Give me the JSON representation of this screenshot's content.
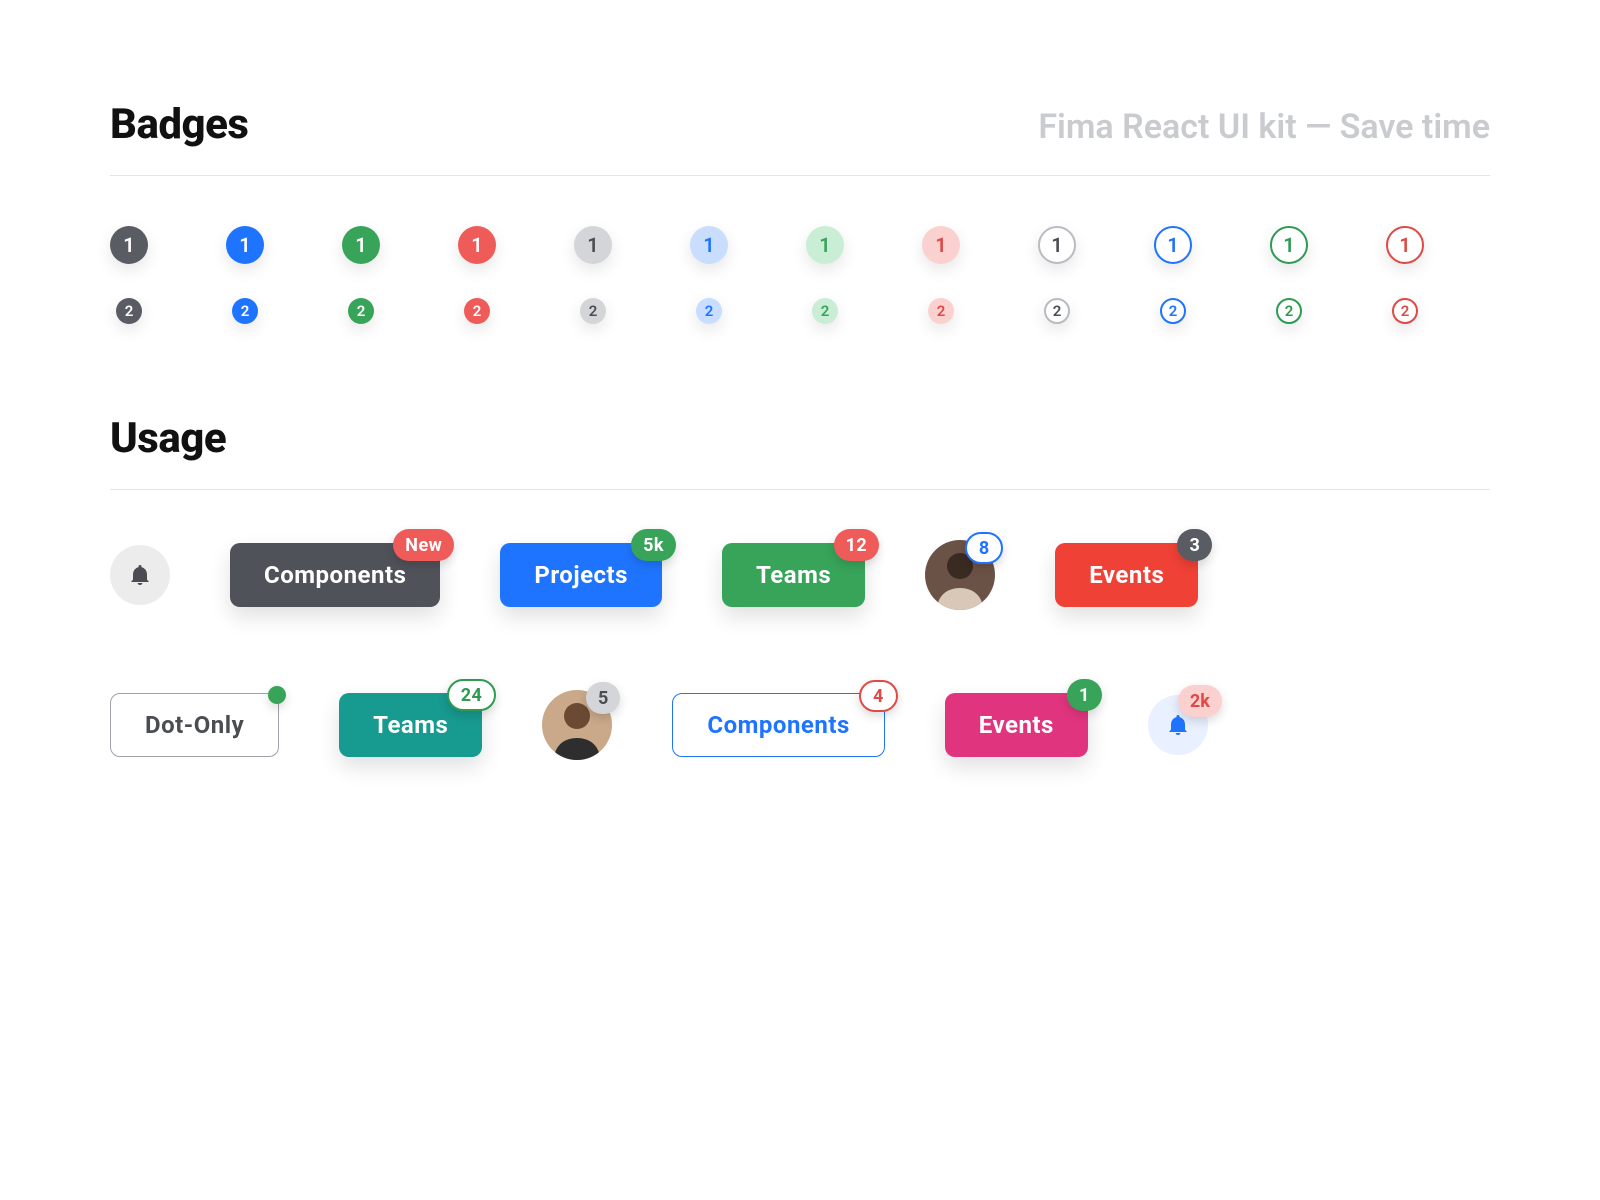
{
  "header": {
    "title": "Badges",
    "subtitle": "Fima React UI kit — Save time"
  },
  "badges": {
    "row1_value": "1",
    "row2_value": "2"
  },
  "usage": {
    "title": "Usage",
    "row1": {
      "components": {
        "label": "Components",
        "badge": "New"
      },
      "projects": {
        "label": "Projects",
        "badge": "5k"
      },
      "teams": {
        "label": "Teams",
        "badge": "12"
      },
      "avatar": {
        "badge": "8"
      },
      "events": {
        "label": "Events",
        "badge": "3"
      }
    },
    "row2": {
      "dotonly": {
        "label": "Dot-Only"
      },
      "teams": {
        "label": "Teams",
        "badge": "24"
      },
      "avatar": {
        "badge": "5"
      },
      "components": {
        "label": "Components",
        "badge": "4"
      },
      "events": {
        "label": "Events",
        "badge": "1"
      },
      "bell": {
        "badge": "2k"
      }
    }
  },
  "colors": {
    "solid_gray": "#595c63",
    "solid_blue": "#1f74ff",
    "solid_green": "#37a45a",
    "solid_red": "#ef5b58",
    "pink": "#e0357e",
    "teal": "#179a8f",
    "red_orange": "#ef4136"
  }
}
